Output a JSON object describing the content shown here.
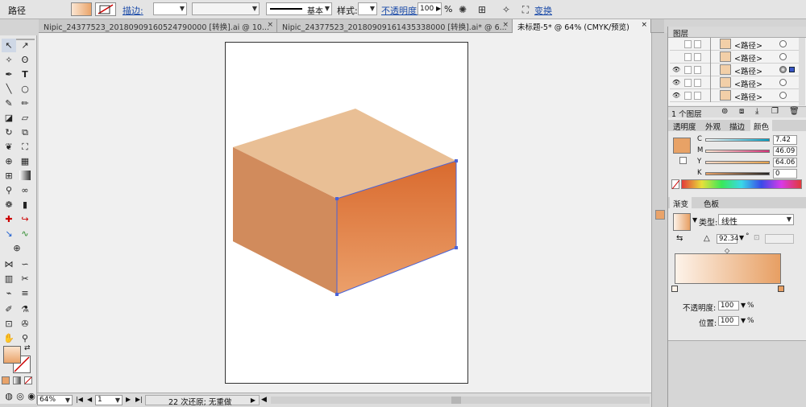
{
  "control_bar": {
    "object_type": "路径",
    "stroke_label": "描边:",
    "stroke_profile": "基本",
    "style_label": "样式:",
    "opacity_label": "不透明度:",
    "opacity_value": "100",
    "opacity_unit": "%",
    "transform_label": "变换"
  },
  "tabs": [
    {
      "label": "Nipic_24377523_20180909160524790000 [转换].ai @ 10..."
    },
    {
      "label": "Nipic_24377523_20180909161435338000 [转换].ai* @ 6..."
    },
    {
      "label": "未标题-5* @ 64% (CMYK/预览)"
    }
  ],
  "status": {
    "zoom": "64%",
    "page": "1",
    "undo_text": "22 次还原; 无重做"
  },
  "layers_panel": {
    "title": "图层",
    "rows": [
      {
        "name": "<路径>"
      },
      {
        "name": "<路径>"
      },
      {
        "name": "<路径>"
      },
      {
        "name": "<路径>"
      },
      {
        "name": "<路径>"
      }
    ],
    "footer_count": "1 个图层"
  },
  "color_panel": {
    "tabs": [
      "透明度",
      "外观",
      "描边",
      "颜色"
    ],
    "channels": [
      {
        "name": "C",
        "value": "7.42"
      },
      {
        "name": "M",
        "value": "46.09"
      },
      {
        "name": "Y",
        "value": "64.06"
      },
      {
        "name": "K",
        "value": "0"
      }
    ],
    "fill_color": "#e8a266"
  },
  "gradient_panel": {
    "tabs": [
      "渐变",
      "色板"
    ],
    "type_label": "类型:",
    "type_value": "线性",
    "angle_value": "92.34",
    "angle_unit": "°",
    "opacity_label": "不透明度:",
    "opacity_value": "100",
    "location_label": "位置:",
    "location_value": "100",
    "unit": "%",
    "gradient_start": "#fdf3ea",
    "gradient_end": "#e79f63"
  },
  "artwork_colors": {
    "top_face": "#e9bf95",
    "left_face": "#d18b5c",
    "front_top": "#d96a2e",
    "front_bottom": "#eba06b",
    "selection": "#4a63d8"
  }
}
